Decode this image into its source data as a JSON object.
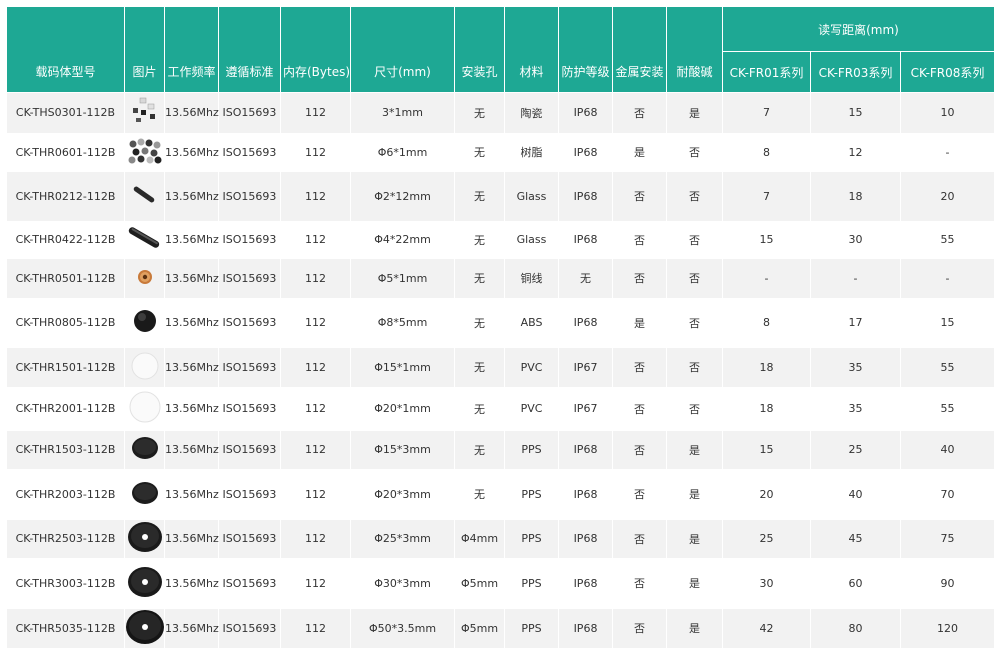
{
  "header": {
    "model": "载码体型号",
    "image": "图片",
    "freq": "工作频率",
    "std": "遵循标准",
    "mem": "内存(Bytes)",
    "size": "尺寸(mm)",
    "hole": "安装孔",
    "mat": "材料",
    "ip": "防护等级",
    "metal": "金属安装",
    "acid": "耐酸碱",
    "dist": "读写距离(mm)",
    "fr01": "CK-FR01系列",
    "fr03": "CK-FR03系列",
    "fr08": "CK-FR08系列"
  },
  "rows": [
    {
      "model": "CK-THS0301-112B",
      "icon": "ceramic-chips-icon",
      "freq": "13.56Mhz",
      "std": "ISO15693",
      "mem": "112",
      "size": "3*1mm",
      "hole": "无",
      "mat": "陶瓷",
      "ip": "IP68",
      "metal": "否",
      "acid": "是",
      "fr01": "7",
      "fr03": "15",
      "fr08": "10"
    },
    {
      "model": "CK-THR0601-112B",
      "icon": "resin-beads-icon",
      "freq": "13.56Mhz",
      "std": "ISO15693",
      "mem": "112",
      "size": "Φ6*1mm",
      "hole": "无",
      "mat": "树脂",
      "ip": "IP68",
      "metal": "是",
      "acid": "否",
      "fr01": "8",
      "fr03": "12",
      "fr08": "-"
    },
    {
      "model": "CK-THR0212-112B",
      "icon": "glass-tube-small-icon",
      "freq": "13.56Mhz",
      "std": "ISO15693",
      "mem": "112",
      "size": "Φ2*12mm",
      "hole": "无",
      "mat": "Glass",
      "ip": "IP68",
      "metal": "否",
      "acid": "否",
      "fr01": "7",
      "fr03": "18",
      "fr08": "20"
    },
    {
      "model": "CK-THR0422-112B",
      "icon": "glass-tube-large-icon",
      "freq": "13.56Mhz",
      "std": "ISO15693",
      "mem": "112",
      "size": "Φ4*22mm",
      "hole": "无",
      "mat": "Glass",
      "ip": "IP68",
      "metal": "否",
      "acid": "否",
      "fr01": "15",
      "fr03": "30",
      "fr08": "55"
    },
    {
      "model": "CK-THR0501-112B",
      "icon": "copper-coil-icon",
      "freq": "13.56Mhz",
      "std": "ISO15693",
      "mem": "112",
      "size": "Φ5*1mm",
      "hole": "无",
      "mat": "铜线",
      "ip": "无",
      "metal": "否",
      "acid": "否",
      "fr01": "-",
      "fr03": "-",
      "fr08": "-"
    },
    {
      "model": "CK-THR0805-112B",
      "icon": "abs-dome-icon",
      "freq": "13.56Mhz",
      "std": "ISO15693",
      "mem": "112",
      "size": "Φ8*5mm",
      "hole": "无",
      "mat": "ABS",
      "ip": "IP68",
      "metal": "是",
      "acid": "否",
      "fr01": "8",
      "fr03": "17",
      "fr08": "15"
    },
    {
      "model": "CK-THR1501-112B",
      "icon": "pvc-disc-small-icon",
      "freq": "13.56Mhz",
      "std": "ISO15693",
      "mem": "112",
      "size": "Φ15*1mm",
      "hole": "无",
      "mat": "PVC",
      "ip": "IP67",
      "metal": "否",
      "acid": "否",
      "fr01": "18",
      "fr03": "35",
      "fr08": "55"
    },
    {
      "model": "CK-THR2001-112B",
      "icon": "pvc-disc-large-icon",
      "freq": "13.56Mhz",
      "std": "ISO15693",
      "mem": "112",
      "size": "Φ20*1mm",
      "hole": "无",
      "mat": "PVC",
      "ip": "IP67",
      "metal": "否",
      "acid": "否",
      "fr01": "18",
      "fr03": "35",
      "fr08": "55"
    },
    {
      "model": "CK-THR1503-112B",
      "icon": "pps-disc-icon",
      "freq": "13.56Mhz",
      "std": "ISO15693",
      "mem": "112",
      "size": "Φ15*3mm",
      "hole": "无",
      "mat": "PPS",
      "ip": "IP68",
      "metal": "否",
      "acid": "是",
      "fr01": "15",
      "fr03": "25",
      "fr08": "40"
    },
    {
      "model": "CK-THR2003-112B",
      "icon": "pps-disc-icon",
      "freq": "13.56Mhz",
      "std": "ISO15693",
      "mem": "112",
      "size": "Φ20*3mm",
      "hole": "无",
      "mat": "PPS",
      "ip": "IP68",
      "metal": "否",
      "acid": "是",
      "fr01": "20",
      "fr03": "40",
      "fr08": "70"
    },
    {
      "model": "CK-THR2503-112B",
      "icon": "pps-washer-icon",
      "freq": "13.56Mhz",
      "std": "ISO15693",
      "mem": "112",
      "size": "Φ25*3mm",
      "hole": "Φ4mm",
      "mat": "PPS",
      "ip": "IP68",
      "metal": "否",
      "acid": "是",
      "fr01": "25",
      "fr03": "45",
      "fr08": "75"
    },
    {
      "model": "CK-THR3003-112B",
      "icon": "pps-washer-icon",
      "freq": "13.56Mhz",
      "std": "ISO15693",
      "mem": "112",
      "size": "Φ30*3mm",
      "hole": "Φ5mm",
      "mat": "PPS",
      "ip": "IP68",
      "metal": "否",
      "acid": "是",
      "fr01": "30",
      "fr03": "60",
      "fr08": "90"
    },
    {
      "model": "CK-THR5035-112B",
      "icon": "pps-washer-large-icon",
      "freq": "13.56Mhz",
      "std": "ISO15693",
      "mem": "112",
      "size": "Φ50*3.5mm",
      "hole": "Φ5mm",
      "mat": "PPS",
      "ip": "IP68",
      "metal": "否",
      "acid": "是",
      "fr01": "42",
      "fr03": "80",
      "fr08": "120"
    }
  ]
}
